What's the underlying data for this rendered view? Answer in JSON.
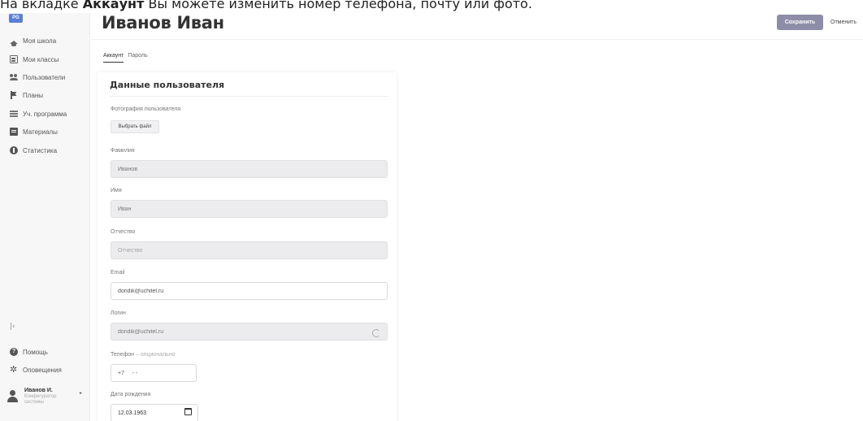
{
  "caption": {
    "pre": "На вкладке ",
    "bold": "Аккаунт",
    "post": " Вы можете изменить номер телефона, почту или фото."
  },
  "logo": "PG",
  "sidebar": {
    "items": [
      {
        "label": "Моя школа",
        "icon": "graduation-cap-icon"
      },
      {
        "label": "Мои классы",
        "icon": "board-icon"
      },
      {
        "label": "Пользователи",
        "icon": "users-icon"
      },
      {
        "label": "Планы",
        "icon": "flag-icon"
      },
      {
        "label": "Уч. программа",
        "icon": "list-icon"
      },
      {
        "label": "Материалы",
        "icon": "book-icon"
      },
      {
        "label": "Статистика",
        "icon": "statistics-icon"
      }
    ],
    "collapse": "|‹",
    "bottom": [
      {
        "label": "Помощь",
        "icon": "help-icon"
      },
      {
        "label": "Оповещения",
        "icon": "gear-icon"
      }
    ],
    "user": {
      "name": "Иванов И.",
      "role": "Конфигуратор системы",
      "arrow": "▸"
    }
  },
  "header": {
    "title": "Иванов Иван",
    "save_label": "Сохранить",
    "cancel_label": "Отменить"
  },
  "tabs": [
    {
      "label": "Аккаунт",
      "active": true
    },
    {
      "label": "Пароль",
      "active": false
    }
  ],
  "form": {
    "title": "Данные пользователя",
    "photo_label": "Фотография пользователя",
    "file_button": "Выбрать файл",
    "last_name": {
      "label": "Фамилия",
      "value": "Иванов"
    },
    "first_name": {
      "label": "Имя",
      "value": "Иван"
    },
    "middle_name": {
      "label": "Отчество",
      "placeholder": "Отчество"
    },
    "email": {
      "label": "Email",
      "value": "dondik@uchitel.ru"
    },
    "login": {
      "label": "Логин",
      "value": "dondik@uchitel.ru"
    },
    "phone": {
      "label": "Телефон",
      "optional": " – опционально",
      "value": "+7     - -"
    },
    "birth_date": {
      "label": "Дата рождения",
      "value": "12.03.1963"
    }
  }
}
